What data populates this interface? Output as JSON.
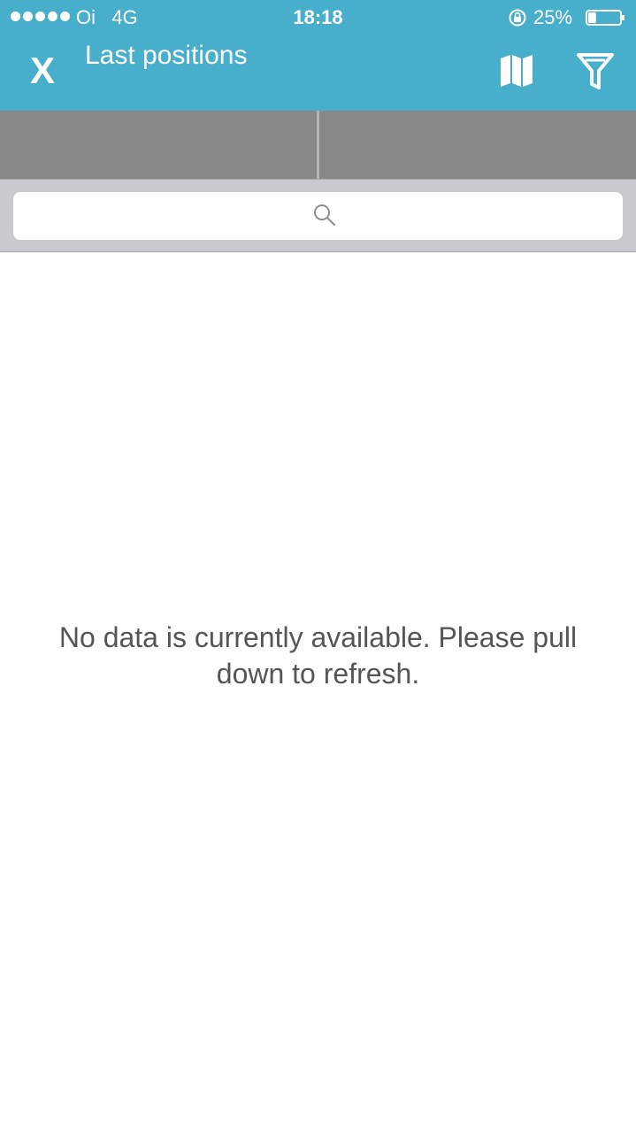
{
  "status_bar": {
    "carrier": "Oi",
    "network": "4G",
    "time": "18:18",
    "battery": "25%",
    "battery_level": 0.25,
    "signal_bars": 5
  },
  "nav": {
    "close_label": "X",
    "title": "Last positions",
    "map_icon": "map-icon",
    "filter_icon": "filter-icon"
  },
  "segments": [
    "",
    ""
  ],
  "search": {
    "placeholder": "",
    "icon": "search-icon"
  },
  "empty_state": {
    "message": "No data is currently available. Please pull down to refresh."
  },
  "colors": {
    "header": "#47aecb",
    "segment_bar": "#888888",
    "search_bg": "#c9c9ce",
    "message_text": "#555555"
  }
}
